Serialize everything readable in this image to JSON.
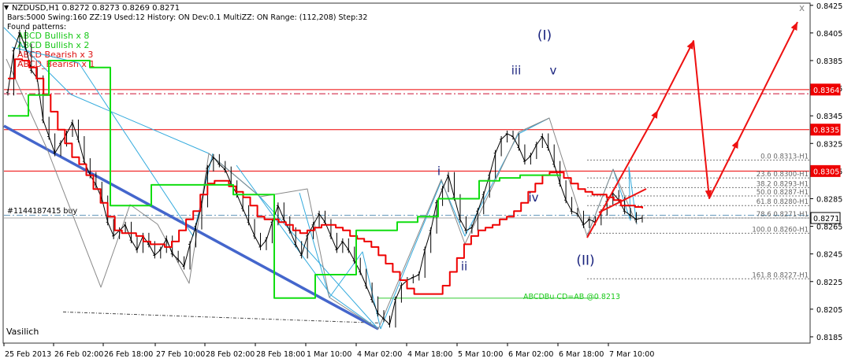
{
  "header": {
    "symbol_line": "NZDUSD,H1  0.8272 0.8273 0.8269 0.8271",
    "info_line": "Bars:5000  Swing:160  ZZ:19  Used:12  History: ON Dev:0.1  MultiZZ: ON  Range: (112,208)  Step:32",
    "found_label": "Found patterns:",
    "patterns": [
      {
        "text": "ABCD Bullish x 8",
        "color": "#19c819"
      },
      {
        "text": "ABCD Bullish x 2",
        "color": "#19c819"
      },
      {
        "text": "ABCD Bearish x 3",
        "color": "#dd1111"
      },
      {
        "text": "ABCD_Bearish x 1",
        "color": "#dd1111"
      }
    ],
    "close_glyph": "x",
    "menu_glyph": "▼"
  },
  "colors": {
    "background": "#ffffff",
    "price": "#000000",
    "red_line": "#ee0000",
    "green_line": "#11dd11",
    "trend_blue": "#4466cc",
    "cyan": "#33aadd",
    "wave_label": "#1a237e",
    "forecast": "#ee1111",
    "fib": "#777777",
    "order": "#6699bb",
    "current_price_tag": "#000000"
  },
  "chart_data": {
    "type": "line",
    "title": "NZDUSD,H1",
    "ylim": [
      0.8181,
      0.8426
    ],
    "y_ticks": [
      "0.8425",
      "0.8405",
      "0.8385",
      "0.8365",
      "0.8345",
      "0.8325",
      "0.8305",
      "0.8285",
      "0.8265",
      "0.8245",
      "0.8225",
      "0.8205",
      "0.8185"
    ],
    "x_ticks": [
      "25 Feb 2013",
      "26 Feb 02:00",
      "26 Feb 18:00",
      "27 Feb 10:00",
      "28 Feb 02:00",
      "28 Feb 18:00",
      "1 Mar 10:00",
      "4 Mar 02:00",
      "4 Mar 18:00",
      "5 Mar 10:00",
      "6 Mar 02:00",
      "6 Mar 18:00",
      "7 Mar 10:00"
    ],
    "series": [
      {
        "values": [
          0.8362,
          0.8392,
          0.8405,
          0.8395,
          0.8378,
          0.8372,
          0.8342,
          0.833,
          0.8318,
          0.8325,
          0.8332,
          0.834,
          0.8328,
          0.8312,
          0.8302,
          0.8295,
          0.8285,
          0.8268,
          0.8258,
          0.8262,
          0.8266,
          0.8255,
          0.8248,
          0.8258,
          0.8252,
          0.8244,
          0.8248,
          0.8256,
          0.8245,
          0.8241,
          0.8236,
          0.8252,
          0.8265,
          0.8281,
          0.8307,
          0.8315,
          0.831,
          0.8306,
          0.8296,
          0.8288,
          0.8278,
          0.8268,
          0.8258,
          0.825,
          0.8255,
          0.8268,
          0.828,
          0.827,
          0.8262,
          0.8252,
          0.8244,
          0.8258,
          0.8266,
          0.8274,
          0.8268,
          0.8258,
          0.8248,
          0.8254,
          0.8248,
          0.824,
          0.8232,
          0.8222,
          0.8212,
          0.8202,
          0.8198,
          0.8194,
          0.8212,
          0.8222,
          0.8226,
          0.8228,
          0.823,
          0.8248,
          0.8262,
          0.8282,
          0.8292,
          0.8302,
          0.8286,
          0.827,
          0.8262,
          0.8264,
          0.8276,
          0.8288,
          0.8302,
          0.8318,
          0.8328,
          0.8332,
          0.833,
          0.8322,
          0.8312,
          0.8316,
          0.8324,
          0.833,
          0.8322,
          0.831,
          0.8296,
          0.8284,
          0.8276,
          0.8274,
          0.8266,
          0.827,
          0.8268,
          0.8275,
          0.8283,
          0.8289,
          0.8284,
          0.8276,
          0.8273,
          0.827,
          0.8271
        ]
      },
      {
        "name": "",
        "values": [
          0.8372,
          0.8386,
          0.8385,
          0.838,
          0.8372,
          0.836,
          0.8348,
          0.8335,
          0.8325,
          0.8315,
          0.831,
          0.8302,
          0.8292,
          0.8282,
          0.8272,
          0.8262,
          0.826,
          0.826,
          0.8258,
          0.8254,
          0.8252,
          0.8252,
          0.825,
          0.8254,
          0.8262,
          0.827,
          0.8276,
          0.8288,
          0.8296,
          0.8298,
          0.8298,
          0.8294,
          0.829,
          0.8286,
          0.828,
          0.8272,
          0.827,
          0.827,
          0.8268,
          0.8266,
          0.8262,
          0.826,
          0.8262,
          0.8264,
          0.8266,
          0.8266,
          0.8264,
          0.8262,
          0.8258,
          0.8256,
          0.8254,
          0.825,
          0.8244,
          0.8238,
          0.8232,
          0.8226,
          0.822,
          0.8216,
          0.8216,
          0.8216,
          0.8216,
          0.8222,
          0.8232,
          0.8242,
          0.8252,
          0.8258,
          0.8262,
          0.8264,
          0.8266,
          0.827,
          0.8272,
          0.8276,
          0.8282,
          0.829,
          0.8296,
          0.8302,
          0.8304,
          0.8304,
          0.83,
          0.8296,
          0.8292,
          0.829,
          0.8288,
          0.8288,
          0.8286,
          0.8284,
          0.828,
          0.828,
          0.8279,
          0.8278
        ]
      },
      {
        "name": "",
        "values": [
          0.8345,
          0.836,
          0.8385,
          0.8385,
          0.838,
          0.828,
          0.828,
          0.8295,
          0.8295,
          0.8295,
          0.8295,
          0.8288,
          0.8288,
          0.8213,
          0.8213,
          0.823,
          0.823,
          0.8262,
          0.8262,
          0.8268,
          0.8272,
          0.8285,
          0.8285,
          0.8298,
          0.83,
          0.8302,
          0.8302,
          0.8302
        ]
      }
    ],
    "horizontal_levels": [
      {
        "label": "0.8364",
        "style": "solid",
        "color": "#ee0000"
      },
      {
        "label": "",
        "style": "dashdot",
        "value": 0.8361,
        "color": "#cc1133"
      },
      {
        "label": "0.8335",
        "style": "solid",
        "color": "#ee0000"
      },
      {
        "label": "0.8305",
        "style": "solid",
        "color": "#ee0000"
      },
      {
        "label": "",
        "style": "dashdot",
        "value": 0.8273,
        "color": "#6699bb"
      },
      {
        "label": "0.8271",
        "style": "solid",
        "color": "#aaaaaa"
      }
    ],
    "fib_levels": [
      {
        "text": "0.0 0.8313-H1"
      },
      {
        "text": "23.6 0.8300-H1"
      },
      {
        "text": "38.2 0.8293-H1"
      },
      {
        "text": "50.0 0.8287-H1"
      },
      {
        "text": "61.8 0.8280-H1"
      },
      {
        "text": "78.6 0.8271-H1"
      },
      {
        "text": "100.0 0.8260-H1"
      },
      {
        "text": "161.8 0.8227-H1"
      }
    ],
    "wave_labels": [
      {
        "text": "(I)",
        "y": 0.84
      },
      {
        "text": "iii",
        "y": 0.8375
      },
      {
        "text": "v",
        "y": 0.8375
      },
      {
        "text": "i",
        "y": 0.8302
      },
      {
        "text": "iv",
        "y": 0.8283
      },
      {
        "text": "ii",
        "y": 0.8233
      },
      {
        "text": "(II)",
        "y": 0.8237
      }
    ],
    "annotations": {
      "order": "#1144187415 buy",
      "abcd": "ABCDBu CD=AB   @0.8213",
      "watermark": "Vasilich"
    },
    "current_price": "0.8271"
  }
}
